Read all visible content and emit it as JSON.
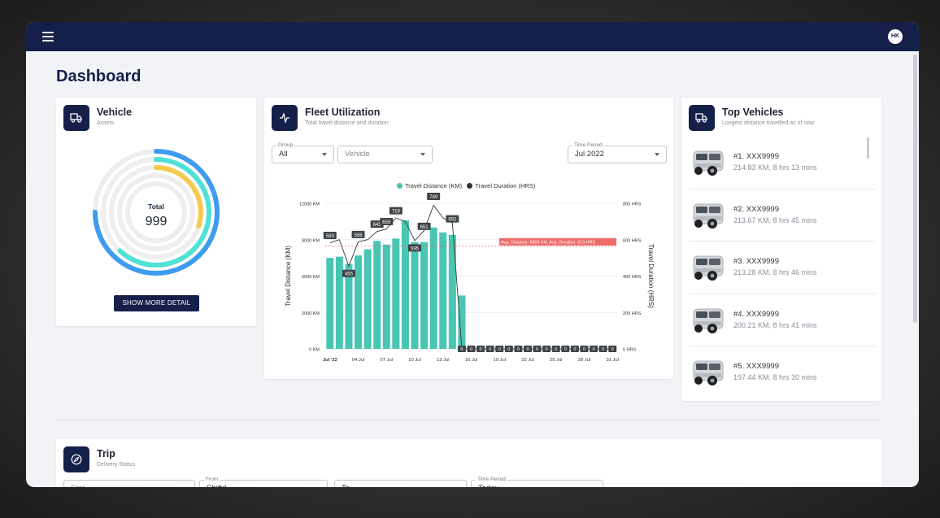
{
  "header": {
    "avatar_initials": "HK"
  },
  "page": {
    "title": "Dashboard"
  },
  "vehicle_card": {
    "title": "Vehicle",
    "subtitle": "Assets",
    "total_label": "Total",
    "total_value": "999",
    "ring_fractions": [
      0.75,
      0.62,
      0.3,
      0,
      0
    ],
    "ring_colors": [
      "#3d9cf0",
      "#4fe0d6",
      "#f5c94b",
      "#eeeeee",
      "#eeeeee"
    ],
    "button_label": "SHOW MORE DETAIL"
  },
  "fleet_card": {
    "title": "Fleet Utilization",
    "subtitle": "Total travel distance and duration",
    "group": {
      "label": "Group",
      "value": "All"
    },
    "vehicle": {
      "placeholder": "Vehicle"
    },
    "period": {
      "label": "Time Period",
      "value": "Jul 2022"
    },
    "legend_distance": "Travel Distance (KM)",
    "legend_duration": "Travel Duration (HRS)"
  },
  "chart_data": {
    "type": "bar",
    "title": "",
    "ylabel": "Travel Distance (KM)",
    "y2label": "Travel Duration (HRS)",
    "ylim": [
      0,
      12000
    ],
    "y2lim": [
      0,
      800
    ],
    "yticks": [
      "0 KM",
      "3000 KM",
      "6000 KM",
      "9000 KM",
      "12000 KM"
    ],
    "y2ticks": [
      "0 HRS",
      "200 HRS",
      "400 HRS",
      "600 HRS",
      "800 HRS"
    ],
    "xticks": [
      "Jul '22",
      "04 Jul",
      "07 Jul",
      "10 Jul",
      "13 Jul",
      "16 Jul",
      "19 Jul",
      "22 Jul",
      "25 Jul",
      "28 Jul",
      "31 Jul"
    ],
    "series": [
      {
        "name": "Travel Distance (KM)",
        "color": "#48c6b3",
        "values": [
          7500,
          7600,
          7000,
          7700,
          8200,
          8900,
          8600,
          9100,
          10600,
          8800,
          8800,
          10000,
          9600,
          9400,
          4400,
          0,
          0,
          0,
          0,
          0,
          0,
          0,
          0,
          0,
          0,
          0,
          0,
          0,
          0,
          0,
          0
        ]
      },
      {
        "name": "Travel Duration (HRS)",
        "color": "#333333",
        "values": [
          583,
          600,
          455,
          588,
          600,
          645,
          659,
          719,
          700,
          595,
          651,
          789,
          720,
          692,
          0,
          0,
          0,
          0,
          0,
          0,
          0,
          0,
          0,
          0,
          0,
          0,
          0,
          0,
          0,
          0,
          0
        ]
      }
    ],
    "point_labels": [
      "583",
      "455",
      "588",
      "645",
      "659",
      "719",
      "595",
      "651",
      "789",
      "692",
      "0"
    ],
    "avg_line_value": 8458,
    "avg_label": "Avg. Distance: 8458 KM, Avg. Duration: 619 HRS"
  },
  "top_card": {
    "title": "Top Vehicles",
    "subtitle": "Longest distance travelled as of now",
    "items": [
      {
        "name": "#1. XXX9999",
        "desc": "214.83 KM, 8 hrs 13 mins"
      },
      {
        "name": "#2. XXX9999",
        "desc": "213.67 KM, 8 hrs 45 mins"
      },
      {
        "name": "#3. XXX9999",
        "desc": "213.28 KM, 8 hrs 46 mins"
      },
      {
        "name": "#4. XXX9999",
        "desc": "200.21 KM, 8 hrs 41 mins"
      },
      {
        "name": "#5. XXX9999",
        "desc": "197.44 KM, 8 hrs 30 mins"
      }
    ]
  },
  "trip_card": {
    "title": "Trip",
    "subtitle": "Delivery Status",
    "filters": [
      {
        "label": "",
        "value": "Stat"
      },
      {
        "label": "From",
        "value": "Shiftd"
      },
      {
        "label": "",
        "value": "To"
      },
      {
        "label": "Time Period",
        "value": "Today"
      }
    ]
  }
}
